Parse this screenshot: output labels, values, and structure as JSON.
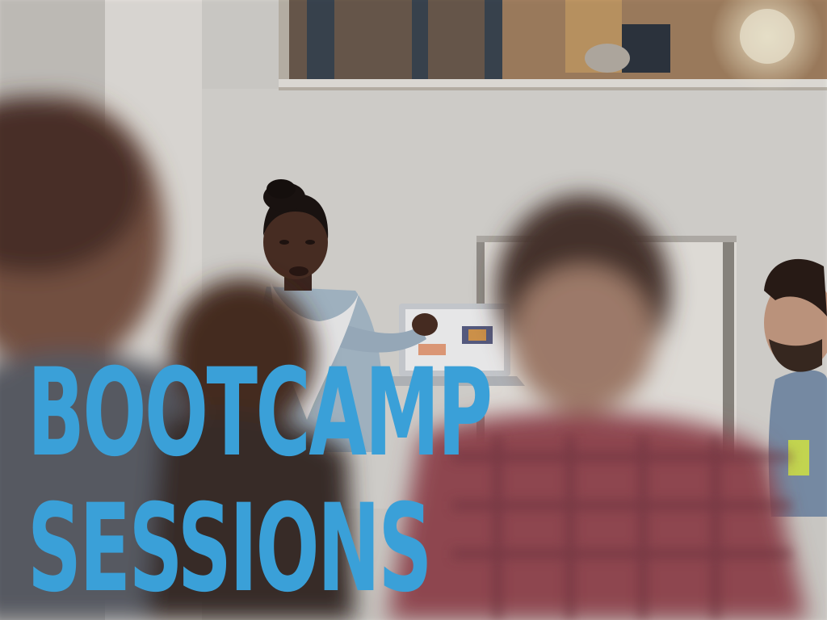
{
  "slide": {
    "title_lines": [
      "BOOTCAMP",
      "SESSIONS"
    ],
    "title_color": "#3aa0d8"
  }
}
